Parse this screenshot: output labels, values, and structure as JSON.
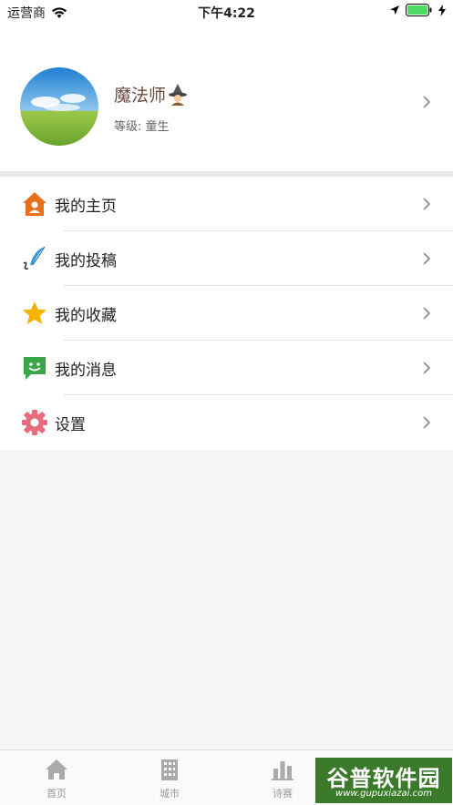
{
  "status_bar": {
    "carrier": "运营商",
    "time": "下午4:22"
  },
  "profile": {
    "nickname": "魔法师",
    "level": "等级: 童生"
  },
  "menu": {
    "items": [
      {
        "label": "我的主页",
        "icon": "home-icon"
      },
      {
        "label": "我的投稿",
        "icon": "quill-icon"
      },
      {
        "label": "我的收藏",
        "icon": "star-icon"
      },
      {
        "label": "我的消息",
        "icon": "message-icon"
      },
      {
        "label": "设置",
        "icon": "gear-icon"
      }
    ]
  },
  "tabbar": {
    "tabs": [
      {
        "label": "首页",
        "icon": "home-icon"
      },
      {
        "label": "城市",
        "icon": "building-icon"
      },
      {
        "label": "诗赛",
        "icon": "bar-chart-icon"
      }
    ]
  },
  "watermark": {
    "title": "谷普软件园",
    "url": "www.gupuxiazai.com"
  },
  "colors": {
    "accent_orange": "#e86f1c",
    "quill_blue": "#3a9bdc",
    "star_yellow": "#f4b400",
    "message_green": "#3aa64a",
    "gear_pink": "#e86c7c",
    "battery_green": "#4cd964"
  }
}
